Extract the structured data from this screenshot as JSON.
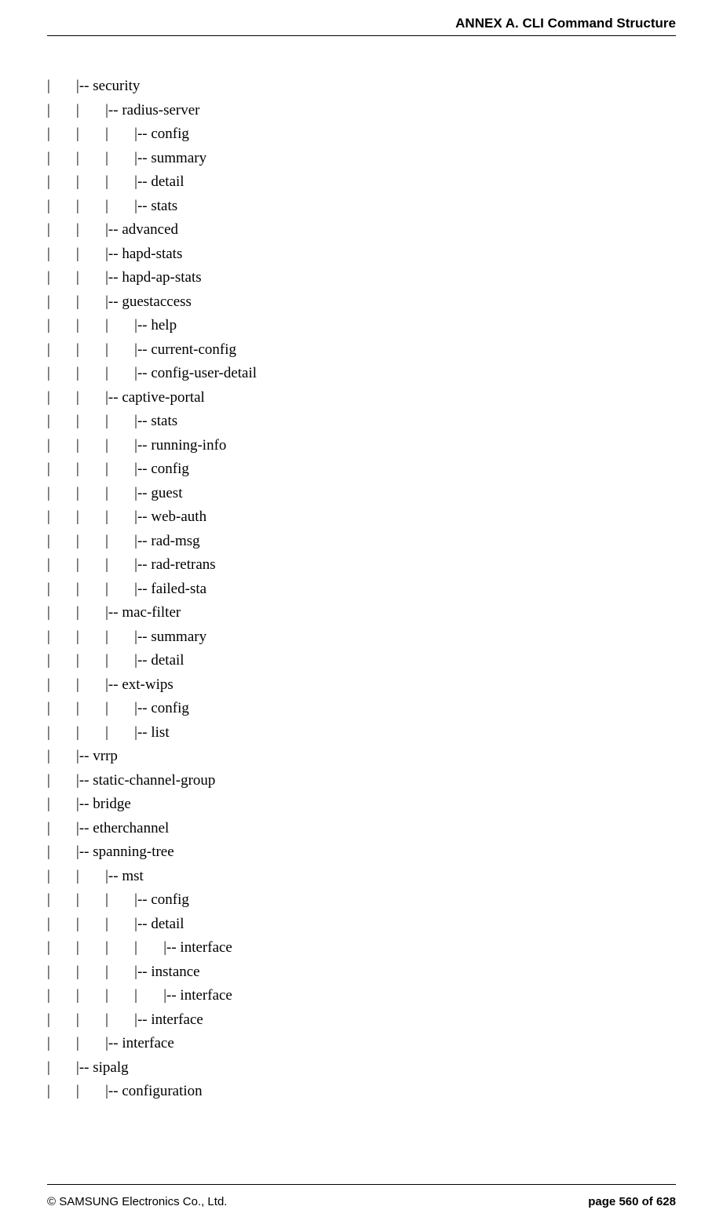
{
  "header": {
    "title": "ANNEX A. CLI Command Structure"
  },
  "footer": {
    "copyright": "© SAMSUNG Electronics Co., Ltd.",
    "page": "page 560 of 628"
  },
  "tree": {
    "lines": [
      "|       |-- security",
      "|       |       |-- radius-server",
      "|       |       |       |-- config",
      "|       |       |       |-- summary",
      "|       |       |       |-- detail",
      "|       |       |       |-- stats",
      "|       |       |-- advanced",
      "|       |       |-- hapd-stats",
      "|       |       |-- hapd-ap-stats",
      "|       |       |-- guestaccess",
      "|       |       |       |-- help",
      "|       |       |       |-- current-config",
      "|       |       |       |-- config-user-detail",
      "|       |       |-- captive-portal",
      "|       |       |       |-- stats",
      "|       |       |       |-- running-info",
      "|       |       |       |-- config",
      "|       |       |       |-- guest",
      "|       |       |       |-- web-auth",
      "|       |       |       |-- rad-msg",
      "|       |       |       |-- rad-retrans",
      "|       |       |       |-- failed-sta",
      "|       |       |-- mac-filter",
      "|       |       |       |-- summary",
      "|       |       |       |-- detail",
      "|       |       |-- ext-wips",
      "|       |       |       |-- config",
      "|       |       |       |-- list",
      "|       |-- vrrp",
      "|       |-- static-channel-group",
      "|       |-- bridge",
      "|       |-- etherchannel",
      "|       |-- spanning-tree",
      "|       |       |-- mst",
      "|       |       |       |-- config",
      "|       |       |       |-- detail",
      "|       |       |       |       |-- interface",
      "|       |       |       |-- instance",
      "|       |       |       |       |-- interface",
      "|       |       |       |-- interface",
      "|       |       |-- interface",
      "|       |-- sipalg",
      "|       |       |-- configuration"
    ]
  }
}
